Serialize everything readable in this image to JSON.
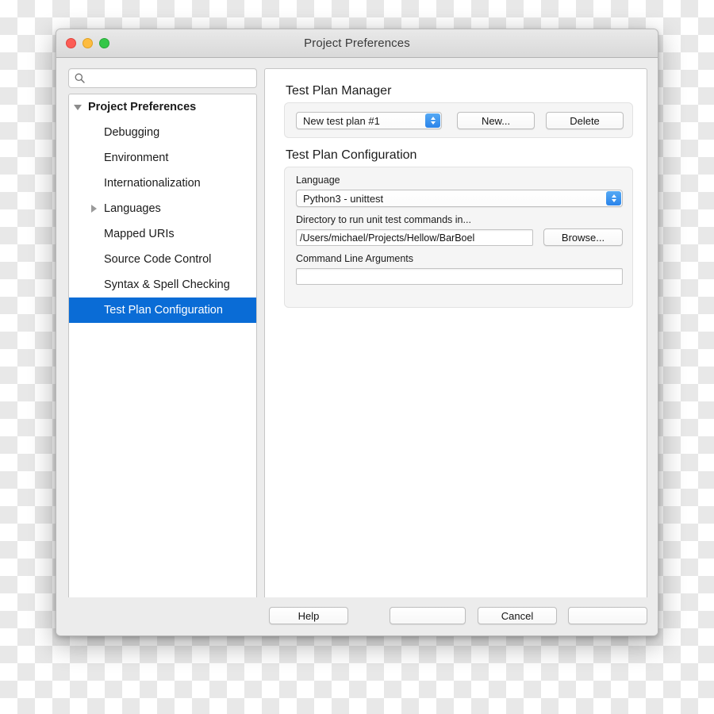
{
  "window": {
    "title": "Project Preferences",
    "traffic_lights": [
      "close-red",
      "minimize-yellow",
      "zoom-green"
    ]
  },
  "sidebar": {
    "search": {
      "value": "",
      "placeholder": "",
      "icon": "search-icon"
    },
    "items": [
      {
        "label": "Project Preferences",
        "level": 0,
        "twisty": "down",
        "selected": false
      },
      {
        "label": "Debugging",
        "level": 1,
        "twisty": "none",
        "selected": false
      },
      {
        "label": "Environment",
        "level": 1,
        "twisty": "none",
        "selected": false
      },
      {
        "label": "Internationalization",
        "level": 1,
        "twisty": "none",
        "selected": false
      },
      {
        "label": "Languages",
        "level": 1,
        "twisty": "right",
        "selected": false
      },
      {
        "label": "Mapped URIs",
        "level": 1,
        "twisty": "none",
        "selected": false
      },
      {
        "label": "Source Code Control",
        "level": 1,
        "twisty": "none",
        "selected": false
      },
      {
        "label": "Syntax & Spell Checking",
        "level": 1,
        "twisty": "none",
        "selected": false
      },
      {
        "label": "Test Plan Configuration",
        "level": 1,
        "twisty": "none",
        "selected": true
      }
    ]
  },
  "main": {
    "manager": {
      "title": "Test Plan Manager",
      "test_plan_value": "New test plan #1",
      "new_label": "New...",
      "delete_label": "Delete"
    },
    "configuration": {
      "title": "Test Plan Configuration",
      "language_label": "Language",
      "language_value": "Python3 - unittest",
      "directory_label": "Directory to run unit test commands in...",
      "directory_value": "/Users/michael/Projects/Hellow/BarBoel",
      "browse_label": "Browse...",
      "arguments_label": "Command Line Arguments",
      "arguments_value": ""
    }
  },
  "footer": {
    "help_label": "Help",
    "blank1_label": "",
    "cancel_label": "Cancel",
    "blank2_label": ""
  },
  "colors": {
    "selection_blue": "#0a6cd6",
    "chevron_blue": "#2a84ea",
    "window_chrome": "#ececec"
  }
}
